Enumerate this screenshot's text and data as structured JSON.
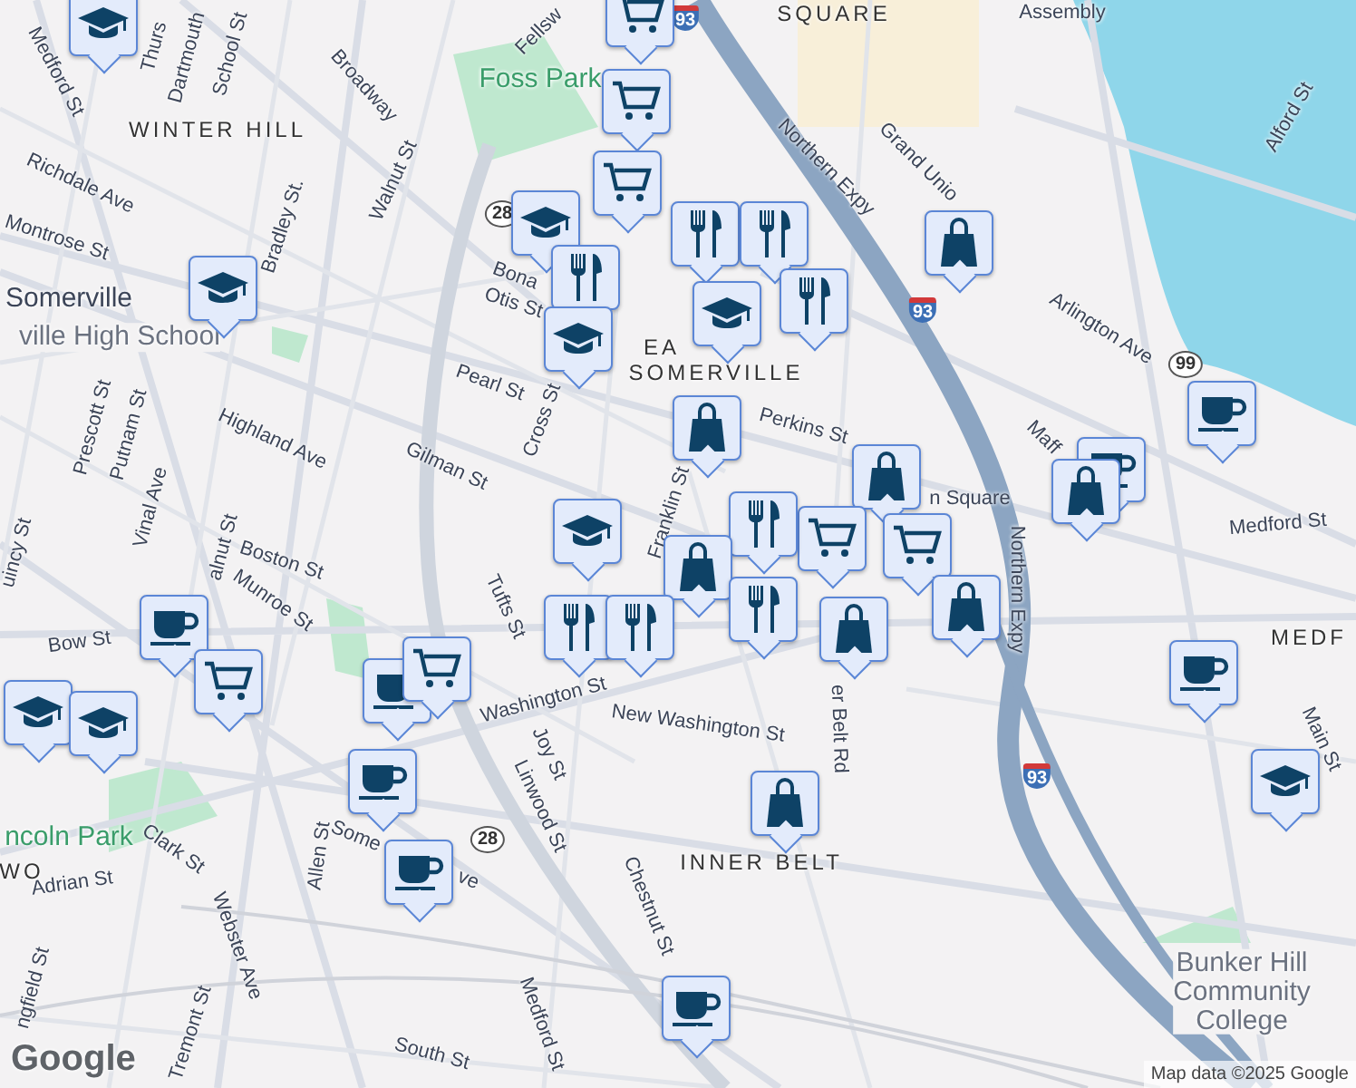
{
  "map": {
    "labels": [
      {
        "text": "SQUARE",
        "kind": "district"
      },
      {
        "text": "Assembly",
        "kind": "transit"
      },
      {
        "text": "Medford St",
        "kind": "street"
      },
      {
        "text": "Thurs",
        "kind": "street"
      },
      {
        "text": "Dartmouth",
        "kind": "street"
      },
      {
        "text": "School St",
        "kind": "street"
      },
      {
        "text": "Broadway",
        "kind": "street"
      },
      {
        "text": "Fellsw",
        "kind": "street"
      },
      {
        "text": "Foss Park",
        "kind": "park"
      },
      {
        "text": "WINTER HILL",
        "kind": "district"
      },
      {
        "text": "Walnut St",
        "kind": "street"
      },
      {
        "text": "Richdale Ave",
        "kind": "street"
      },
      {
        "text": "Montrose St",
        "kind": "street"
      },
      {
        "text": "Bradley St.",
        "kind": "street"
      },
      {
        "text": "Somerville",
        "kind": "place"
      },
      {
        "text": "ville High School",
        "kind": "poi"
      },
      {
        "text": "Bona",
        "kind": "street"
      },
      {
        "text": "Otis St",
        "kind": "street"
      },
      {
        "text": "Pearl St",
        "kind": "street"
      },
      {
        "text": "Cross St",
        "kind": "street"
      },
      {
        "text": "Highland Ave",
        "kind": "street"
      },
      {
        "text": "Gilman St",
        "kind": "street"
      },
      {
        "text": "Prescott St",
        "kind": "street"
      },
      {
        "text": "Putnam St",
        "kind": "street"
      },
      {
        "text": "Vinal Ave",
        "kind": "street"
      },
      {
        "text": "EA",
        "kind": "district"
      },
      {
        "text": "SOMERVILLE",
        "kind": "district"
      },
      {
        "text": "Northern Expy",
        "kind": "street"
      },
      {
        "text": "Grand Unio",
        "kind": "street"
      },
      {
        "text": "Arlington Ave",
        "kind": "street"
      },
      {
        "text": "Alford St",
        "kind": "street"
      },
      {
        "text": "Maff",
        "kind": "street"
      },
      {
        "text": "Perkins St",
        "kind": "street"
      },
      {
        "text": "n Square",
        "kind": "transit"
      },
      {
        "text": "Medford St",
        "kind": "street"
      },
      {
        "text": "Franklin St",
        "kind": "street"
      },
      {
        "text": "Northern Expy",
        "kind": "street"
      },
      {
        "text": "MEDF",
        "kind": "district"
      },
      {
        "text": "Main St",
        "kind": "street"
      },
      {
        "text": "alnut St",
        "kind": "street"
      },
      {
        "text": "Boston St",
        "kind": "street"
      },
      {
        "text": "Munroe St",
        "kind": "street"
      },
      {
        "text": "uincy St",
        "kind": "street"
      },
      {
        "text": "Bow St",
        "kind": "street"
      },
      {
        "text": "Tufts St",
        "kind": "street"
      },
      {
        "text": "Washington St",
        "kind": "street"
      },
      {
        "text": "New Washington St",
        "kind": "street"
      },
      {
        "text": "er Belt Rd",
        "kind": "street"
      },
      {
        "text": "Joy St",
        "kind": "street"
      },
      {
        "text": "Linwood St",
        "kind": "street"
      },
      {
        "text": "INNER BELT",
        "kind": "district"
      },
      {
        "text": "ncoln Park",
        "kind": "park"
      },
      {
        "text": "WO",
        "kind": "district"
      },
      {
        "text": "Clark St",
        "kind": "street"
      },
      {
        "text": "Adrian St",
        "kind": "street"
      },
      {
        "text": "Allen St",
        "kind": "street"
      },
      {
        "text": "Some",
        "kind": "street"
      },
      {
        "text": "ve",
        "kind": "street"
      },
      {
        "text": "Chestnut St",
        "kind": "street"
      },
      {
        "text": "Webster Ave",
        "kind": "street"
      },
      {
        "text": "Tremont St",
        "kind": "street"
      },
      {
        "text": "ngfield St",
        "kind": "street"
      },
      {
        "text": "South St",
        "kind": "street"
      },
      {
        "text": "Medford St",
        "kind": "street"
      },
      {
        "text": "Bunker Hill Community College",
        "kind": "poi"
      }
    ],
    "shields": [
      {
        "text": "93",
        "kind": "interstate"
      },
      {
        "text": "28",
        "kind": "route"
      },
      {
        "text": "93",
        "kind": "interstate"
      },
      {
        "text": "99",
        "kind": "route"
      },
      {
        "text": "93",
        "kind": "interstate"
      },
      {
        "text": "28",
        "kind": "route"
      }
    ],
    "markers": [
      {
        "kind": "school"
      },
      {
        "kind": "cart"
      },
      {
        "kind": "cart"
      },
      {
        "kind": "cart"
      },
      {
        "kind": "school"
      },
      {
        "kind": "food"
      },
      {
        "kind": "food"
      },
      {
        "kind": "food"
      },
      {
        "kind": "food"
      },
      {
        "kind": "school"
      },
      {
        "kind": "school"
      },
      {
        "kind": "school"
      },
      {
        "kind": "shop"
      },
      {
        "kind": "shop"
      },
      {
        "kind": "cafe"
      },
      {
        "kind": "cafe"
      },
      {
        "kind": "shop"
      },
      {
        "kind": "school"
      },
      {
        "kind": "shop"
      },
      {
        "kind": "cart"
      },
      {
        "kind": "food"
      },
      {
        "kind": "cart"
      },
      {
        "kind": "shop"
      },
      {
        "kind": "shop"
      },
      {
        "kind": "food"
      },
      {
        "kind": "food"
      },
      {
        "kind": "food"
      },
      {
        "kind": "shop"
      },
      {
        "kind": "cafe"
      },
      {
        "kind": "cart"
      },
      {
        "kind": "cafe"
      },
      {
        "kind": "cart"
      },
      {
        "kind": "school"
      },
      {
        "kind": "school"
      },
      {
        "kind": "cafe"
      },
      {
        "kind": "cafe"
      },
      {
        "kind": "cafe"
      },
      {
        "kind": "shop"
      },
      {
        "kind": "school"
      },
      {
        "kind": "cafe"
      }
    ],
    "logo": "Google",
    "attribution": "Map data ©2025 Google"
  }
}
